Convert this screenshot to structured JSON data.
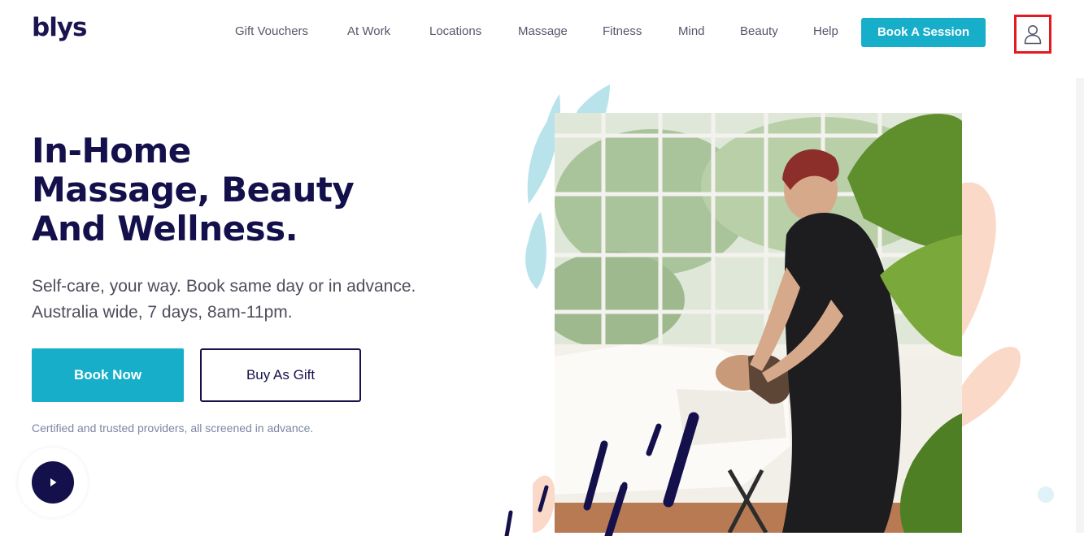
{
  "brand": {
    "logo": "blys"
  },
  "nav": {
    "items": [
      {
        "label": "Gift Vouchers"
      },
      {
        "label": "At Work"
      },
      {
        "label": "Locations"
      },
      {
        "label": "Massage"
      },
      {
        "label": "Fitness"
      },
      {
        "label": "Mind"
      },
      {
        "label": "Beauty"
      },
      {
        "label": "Help"
      }
    ],
    "cta": "Book A Session",
    "account_icon": "user-icon"
  },
  "hero": {
    "title_lines": [
      "In-Home",
      "Massage, Beauty",
      "And Wellness."
    ],
    "subtitle_lines": [
      "Self-care, your way. Book same day or in advance.",
      "Australia wide, 7 days, 8am-11pm."
    ],
    "primary_button": "Book Now",
    "secondary_button": "Buy As Gift",
    "note": "Certified and trusted providers, all screened in advance.",
    "video_icon": "play-icon"
  },
  "colors": {
    "brand_navy": "#14104b",
    "accent_teal": "#17aec9",
    "leaf_blue": "#b5e1ea",
    "peach": "#fbd9c8",
    "highlight_red": "#e21a22"
  }
}
